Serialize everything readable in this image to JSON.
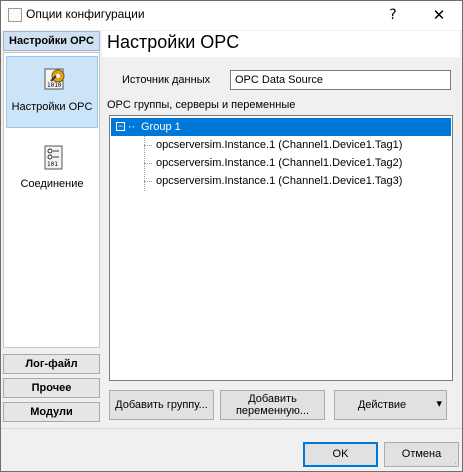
{
  "window": {
    "title": "Опции конфигурации",
    "help_label": "?",
    "close_label": "✕"
  },
  "nav": {
    "header": "Настройки OPC",
    "items": [
      {
        "label": "Настройки OPC",
        "icon": "opc-settings-icon",
        "selected": true
      },
      {
        "label": "Соединение",
        "icon": "connection-icon",
        "selected": false
      }
    ],
    "buttons": [
      "Лог-файл",
      "Прочее",
      "Модули"
    ]
  },
  "main": {
    "title": "Настройки OPC",
    "source_label": "Источник данных",
    "source_value": "OPC Data Source",
    "tree_label": "OPC группы, серверы и переменные",
    "tree": {
      "root": "Group 1",
      "children": [
        "opcserversim.Instance.1 (Channel1.Device1.Tag1)",
        "opcserversim.Instance.1 (Channel1.Device1.Tag2)",
        "opcserversim.Instance.1 (Channel1.Device1.Tag3)"
      ]
    },
    "buttons": {
      "add_group": "Добавить группу...",
      "add_variable_line1": "Добавить",
      "add_variable_line2": "переменную...",
      "action": "Действие",
      "action_arrow": "▾"
    }
  },
  "footer": {
    "ok": "OK",
    "cancel": "Отмена"
  },
  "colors": {
    "selection": "#0078d7",
    "nav_selected": "#cce4f7"
  }
}
